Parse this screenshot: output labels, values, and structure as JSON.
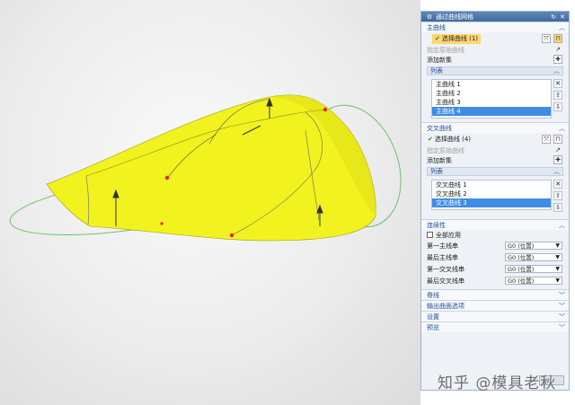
{
  "dialog": {
    "title": "通过曲线网格",
    "icons": {
      "gear": "gear-icon",
      "reset": "reset-icon",
      "close": "close-icon"
    }
  },
  "primary": {
    "header": "主曲线",
    "select_label": "选择曲线 (1)",
    "reverse_label": "指定原始曲线",
    "add_new": "添加新集",
    "list_header": "列表",
    "items": [
      "主曲线 1",
      "主曲线 2",
      "主曲线 3",
      "主曲线 4"
    ],
    "active_index": 3
  },
  "cross": {
    "header": "交叉曲线",
    "select_label": "选择曲线 (4)",
    "reverse_label": "指定原始曲线",
    "add_new": "添加新集",
    "list_header": "列表",
    "items": [
      "交叉曲线 1",
      "交叉曲线 2",
      "交叉曲线 3"
    ],
    "active_index": 2
  },
  "continuity": {
    "header": "连续性",
    "all_apply": "全部应用",
    "rows": [
      {
        "label": "第一主线串",
        "value": "G0 (位置)"
      },
      {
        "label": "最后主线串",
        "value": "G0 (位置)"
      },
      {
        "label": "第一交叉线串",
        "value": "G0 (位置)"
      },
      {
        "label": "最后交叉线串",
        "value": "G0 (位置)"
      }
    ]
  },
  "collapsed": [
    "脊线",
    "输出曲面选项",
    "设置",
    "预览"
  ],
  "watermark": "知乎 @模具老秋",
  "colors": {
    "surface": "#f2f21e",
    "accent": "#1e4f95",
    "selection": "#ffd76e",
    "list_active": "#3d8de5"
  }
}
